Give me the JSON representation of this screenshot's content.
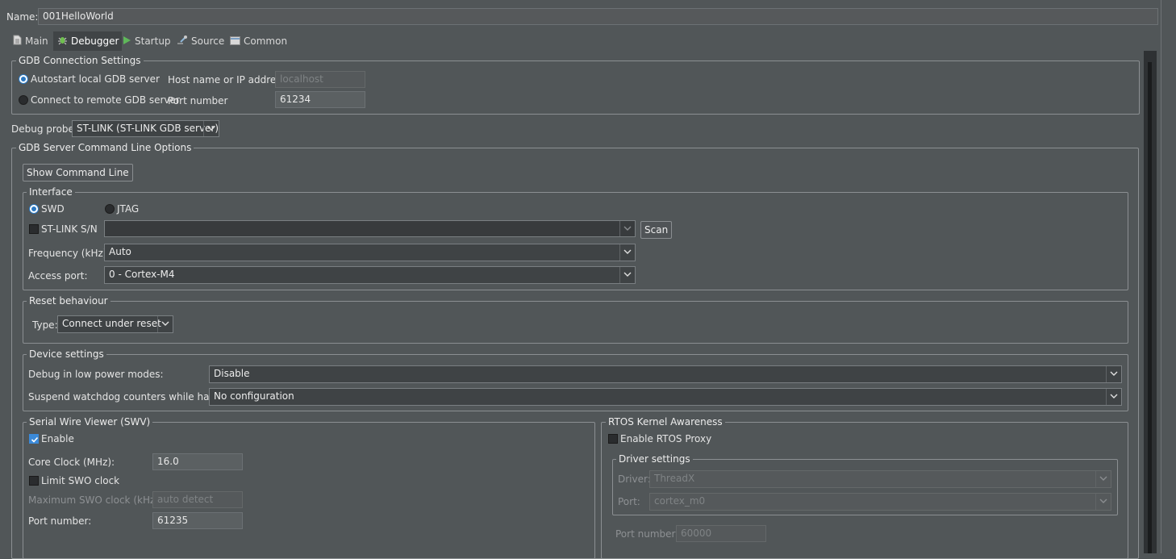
{
  "name_field": {
    "label": "Name:",
    "value": "001HelloWorld"
  },
  "tabs": [
    {
      "label": "Main",
      "icon": "main-doc-icon"
    },
    {
      "label": "Debugger",
      "icon": "bug-icon",
      "active": true
    },
    {
      "label": "Startup",
      "icon": "play-icon"
    },
    {
      "label": "Source",
      "icon": "source-icon"
    },
    {
      "label": "Common",
      "icon": "common-icon"
    }
  ],
  "gdb_connection": {
    "title": "GDB Connection Settings",
    "autostart_label": "Autostart local GDB server",
    "remote_label": "Connect to remote GDB server",
    "host_label": "Host name or IP address",
    "host_value": "localhost",
    "port_label": "Port number",
    "port_value": "61234"
  },
  "debug_probe": {
    "label": "Debug probe",
    "value": "ST-LINK (ST-LINK GDB server)"
  },
  "gdb_server_options": {
    "title": "GDB Server Command Line Options",
    "show_cmd_label": "Show Command Line"
  },
  "interface": {
    "title": "Interface",
    "swd_label": "SWD",
    "jtag_label": "JTAG",
    "stlink_sn_label": "ST-LINK S/N",
    "stlink_sn_value": "",
    "scan_label": "Scan",
    "frequency_label": "Frequency (kHz):",
    "frequency_value": "Auto",
    "access_port_label": "Access port:",
    "access_port_value": "0 - Cortex-M4"
  },
  "reset": {
    "title": "Reset behaviour",
    "type_label": "Type:",
    "type_value": "Connect under reset"
  },
  "device": {
    "title": "Device settings",
    "low_power_label": "Debug in low power modes:",
    "low_power_value": "Disable",
    "watchdog_label": "Suspend watchdog counters while halted:",
    "watchdog_value": "No configuration"
  },
  "swv": {
    "title": "Serial Wire Viewer (SWV)",
    "enable_label": "Enable",
    "core_clock_label": "Core Clock (MHz):",
    "core_clock_value": "16.0",
    "limit_swo_label": "Limit SWO clock",
    "max_swo_label": "Maximum SWO clock (kHz):",
    "max_swo_value": "auto detect",
    "port_label": "Port number:",
    "port_value": "61235"
  },
  "rtos": {
    "title": "RTOS Kernel Awareness",
    "enable_proxy_label": "Enable RTOS Proxy",
    "driver_settings_title": "Driver settings",
    "driver_label": "Driver:",
    "driver_value": "ThreadX",
    "port_label": "Port:",
    "port_value": "cortex_m0",
    "port_number_label": "Port number:",
    "port_number_value": "60000"
  },
  "colors": {
    "background": "#515658",
    "accent": "#3b8ad9",
    "border": "#8b8f92"
  }
}
